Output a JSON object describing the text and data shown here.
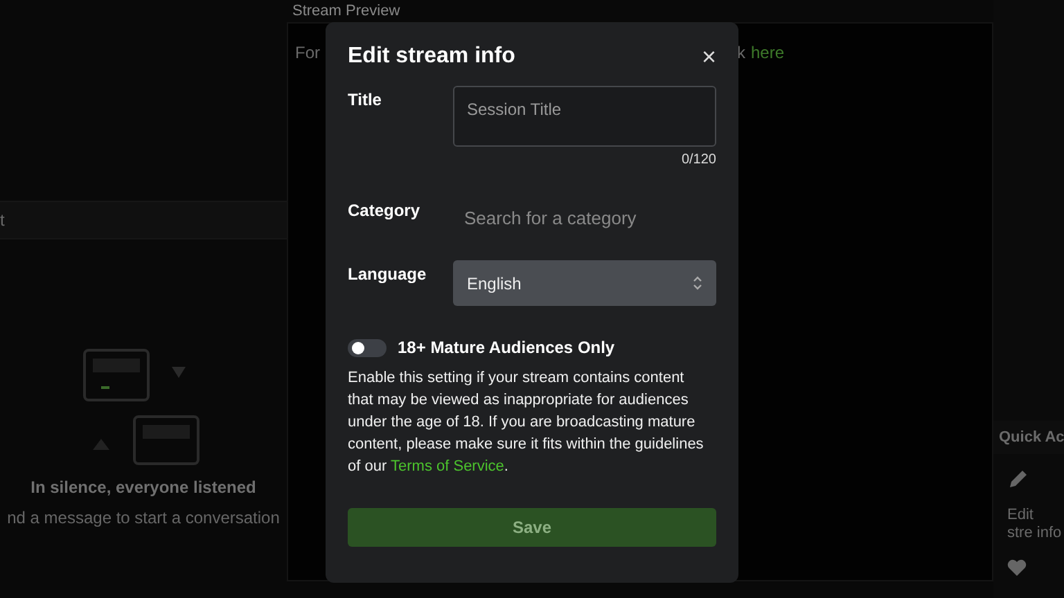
{
  "chat": {
    "header": "t",
    "empty_title": "In silence, everyone listened",
    "empty_hint": "nd a message to start a conversation"
  },
  "preview": {
    "title": "Stream Preview",
    "note_left": "For",
    "note_right": "k",
    "link": "here"
  },
  "quick_actions": {
    "title": "Quick Ac",
    "items": [
      {
        "label": "Edit stre info"
      }
    ]
  },
  "dialog": {
    "title": "Edit stream info",
    "close": "×",
    "fields": [
      {
        "kind": "textarea",
        "label": "Title",
        "placeholder": "Session Title",
        "counter": "0/120"
      },
      {
        "kind": "search",
        "label": "Category",
        "placeholder": "Search for a category"
      },
      {
        "kind": "select",
        "label": "Language",
        "value": "English"
      }
    ],
    "mature": {
      "label": "18+ Mature Audiences Only",
      "on": false,
      "description": "Enable this setting if your stream contains content that may be viewed as inappropriate for audiences under the age of 18. If you are broadcasting mature content, please make sure it fits within the guidelines of our ",
      "link": "Terms of Service",
      "after": "."
    },
    "save": {
      "label": "Save",
      "disabled": true
    }
  }
}
